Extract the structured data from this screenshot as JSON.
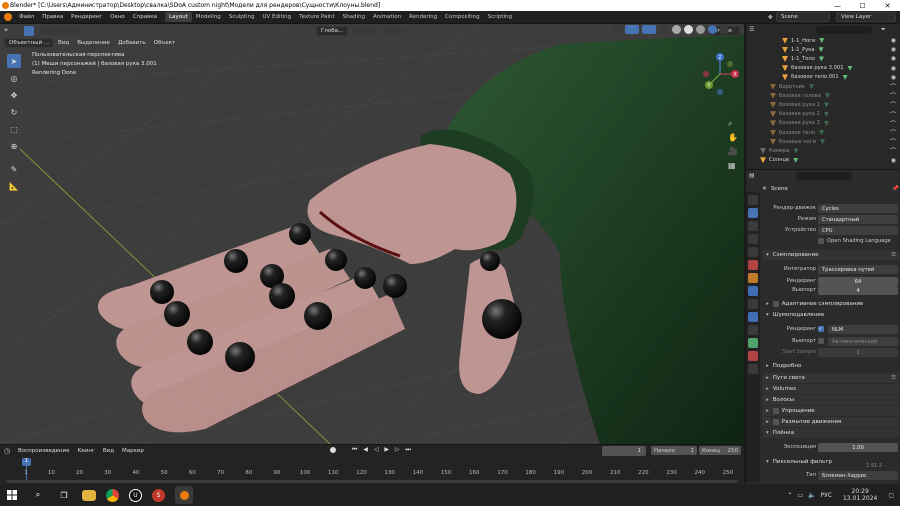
{
  "window": {
    "title": "Blender* [C:\\Users\\Администратор\\Desktop\\свалка\\SDoA custom night\\Модели для рендеров\\Сущности\\Клоуны.blend]",
    "minimize": "—",
    "maximize": "☐",
    "close": "✕"
  },
  "topmenu": {
    "items": [
      "Файл",
      "Правка",
      "Рендеринг",
      "Окно",
      "Справка"
    ],
    "workspaces": [
      "Layout",
      "Modeling",
      "Sculpting",
      "UV Editing",
      "Texture Paint",
      "Shading",
      "Animation",
      "Rendering",
      "Compositing",
      "Scripting"
    ],
    "scene": "Scene",
    "view_layer": "View Layer"
  },
  "viewport": {
    "mode": "Объектный ...",
    "menus": [
      "Вид",
      "Выделение",
      "Добавить",
      "Объект"
    ],
    "transform": "Глоба...",
    "options": "Опции",
    "info_line1": "Пользовательская перспектива",
    "info_line2": "(1) Меши персонажей | базовая рука 3.001",
    "info_line3": "Rendering Done",
    "gizmo": {
      "x": "X",
      "y": "Y",
      "z": "Z"
    }
  },
  "timeline": {
    "menus": [
      "Воспроизведение",
      "Кеинг",
      "Вид",
      "Маркер"
    ],
    "current_frame": "1",
    "start_label": "Начало",
    "start_value": "1",
    "end_label": "Конец",
    "end_value": "250",
    "ticks": [
      "1",
      "10",
      "20",
      "30",
      "40",
      "50",
      "60",
      "70",
      "80",
      "90",
      "100",
      "110",
      "120",
      "130",
      "140",
      "150",
      "160",
      "170",
      "180",
      "190",
      "200",
      "210",
      "220",
      "230",
      "240",
      "250"
    ]
  },
  "outliner": {
    "rows": [
      {
        "name": "1-1_Ноги",
        "dim": false
      },
      {
        "name": "1-1_Рука",
        "dim": false
      },
      {
        "name": "1-1_Тело",
        "dim": false
      },
      {
        "name": "базовая рука 3.001",
        "dim": false
      },
      {
        "name": "базовое тело.001",
        "dim": false
      },
      {
        "name": "Варотник",
        "dim": true
      },
      {
        "name": "базовая голова",
        "dim": true
      },
      {
        "name": "базовая рука 1",
        "dim": true
      },
      {
        "name": "базовая рука 2",
        "dim": true
      },
      {
        "name": "базовая рука 3",
        "dim": true
      },
      {
        "name": "базовое тело",
        "dim": true
      },
      {
        "name": "базовые ноги",
        "dim": true
      },
      {
        "name": "Камера",
        "dim": true
      },
      {
        "name": "Солнце",
        "dim": false
      }
    ]
  },
  "properties": {
    "scene_name": "Scene",
    "render_engine_label": "Рендер-движок",
    "render_engine": "Cycles",
    "mode_label": "Режим",
    "mode": "Стандартный",
    "device_label": "Устройство",
    "device": "CPU",
    "osl": "Open Shading Language",
    "sampling": "Сэмплирование",
    "integrator_label": "Интегратор",
    "integrator": "Трассировка путей",
    "render_label": "Рендеринг",
    "render_samples": "64",
    "viewport_label": "Вьюпорт",
    "viewport_samples": "4",
    "adaptive": "Адаптивное сэмплирование",
    "denoise": "Шумоподавление",
    "denoise_render_label": "Рендеринг",
    "denoise_render": "NLM",
    "denoise_viewport_label": "Вьюпорт",
    "denoise_viewport": "Автоматический",
    "start_sample_label": "Start Sample",
    "start_sample": "1",
    "more": "Подробно",
    "light_paths": "Пути света",
    "volumes": "Volumes",
    "hair": "Волосы",
    "simplify": "Упрощение",
    "motion_blur": "Размытие движения",
    "film": "Плёнка",
    "exposure_label": "Экспозиция",
    "exposure": "1.00",
    "pixel_filter": "Пиксельный фильтр",
    "type_label": "Тип",
    "type": "Блэкман-Харрис",
    "version": "2.91.2"
  },
  "taskbar": {
    "time": "20:29",
    "date": "13.01.2024",
    "lang": "РУС"
  },
  "colors": {
    "accent": "#4772b3",
    "viewport_bg": "#3d3d3d",
    "sleeve": "#1f3a22",
    "hand": "#b49c96"
  }
}
